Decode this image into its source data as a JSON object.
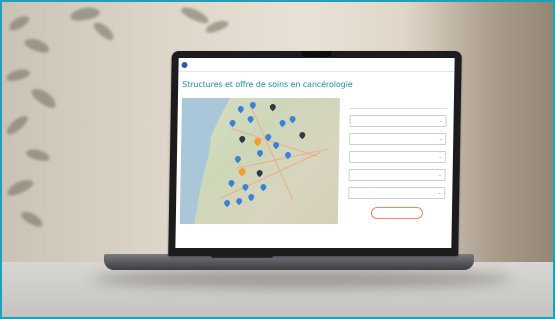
{
  "page": {
    "topbar_text": "",
    "title": "Structures et offre de soins en cancérologie",
    "map_caption": ""
  },
  "filters": {
    "header": "",
    "items": [
      {
        "label": ""
      },
      {
        "label": ""
      },
      {
        "label": ""
      },
      {
        "label": ""
      },
      {
        "label": ""
      }
    ],
    "reset_label": ""
  },
  "colors": {
    "frame": "#1f9fb8",
    "title": "#1b8fb0",
    "marker_blue": "#3b82d6",
    "marker_dark": "#2f3a44",
    "marker_orange": "#f0a030",
    "reset_button": "#f08a5b"
  },
  "icons": [
    "map-marker-icon",
    "chevron-down-icon",
    "site-logo-icon"
  ]
}
